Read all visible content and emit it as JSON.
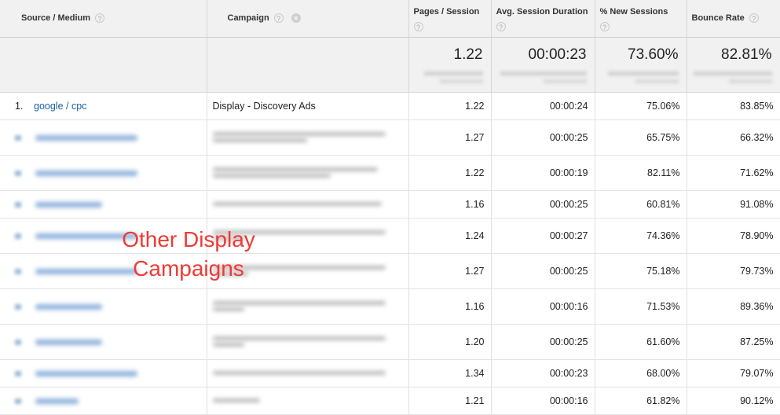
{
  "headers": {
    "source_medium": "Source / Medium",
    "campaign": "Campaign",
    "pages_session": "Pages / Session",
    "avg_duration": "Avg. Session Duration",
    "new_sessions": "% New Sessions",
    "bounce_rate": "Bounce Rate",
    "help_glyph": "?",
    "remove_glyph": "×"
  },
  "totals": {
    "pages_session": "1.22",
    "avg_duration": "00:00:23",
    "new_sessions": "73.60%",
    "bounce_rate": "82.81%"
  },
  "first_row": {
    "index": "1.",
    "source": "google / cpc",
    "campaign": "Display - Discovery Ads",
    "pages_session": "1.22",
    "avg_duration": "00:00:24",
    "new_sessions": "75.06%",
    "bounce_rate": "83.85%"
  },
  "rows": [
    {
      "pages_session": "1.27",
      "avg_duration": "00:00:25",
      "new_sessions": "65.75%",
      "bounce_rate": "66.32%"
    },
    {
      "pages_session": "1.22",
      "avg_duration": "00:00:19",
      "new_sessions": "82.11%",
      "bounce_rate": "71.62%"
    },
    {
      "pages_session": "1.16",
      "avg_duration": "00:00:25",
      "new_sessions": "60.81%",
      "bounce_rate": "91.08%"
    },
    {
      "pages_session": "1.24",
      "avg_duration": "00:00:27",
      "new_sessions": "74.36%",
      "bounce_rate": "78.90%"
    },
    {
      "pages_session": "1.27",
      "avg_duration": "00:00:25",
      "new_sessions": "75.18%",
      "bounce_rate": "79.73%"
    },
    {
      "pages_session": "1.16",
      "avg_duration": "00:00:16",
      "new_sessions": "71.53%",
      "bounce_rate": "89.36%"
    },
    {
      "pages_session": "1.20",
      "avg_duration": "00:00:25",
      "new_sessions": "61.60%",
      "bounce_rate": "87.25%"
    },
    {
      "pages_session": "1.34",
      "avg_duration": "00:00:23",
      "new_sessions": "68.00%",
      "bounce_rate": "79.07%"
    },
    {
      "pages_session": "1.21",
      "avg_duration": "00:00:16",
      "new_sessions": "61.82%",
      "bounce_rate": "90.12%"
    }
  ],
  "overlay": {
    "line1": "Other Display",
    "line2": "Campaigns"
  },
  "icons": {
    "help": "help-circle-icon",
    "remove": "remove-dimension-icon"
  },
  "colors": {
    "link": "#1a5fa5",
    "overlay_text": "#ee3a35",
    "header_bg": "#f1f1f1"
  }
}
